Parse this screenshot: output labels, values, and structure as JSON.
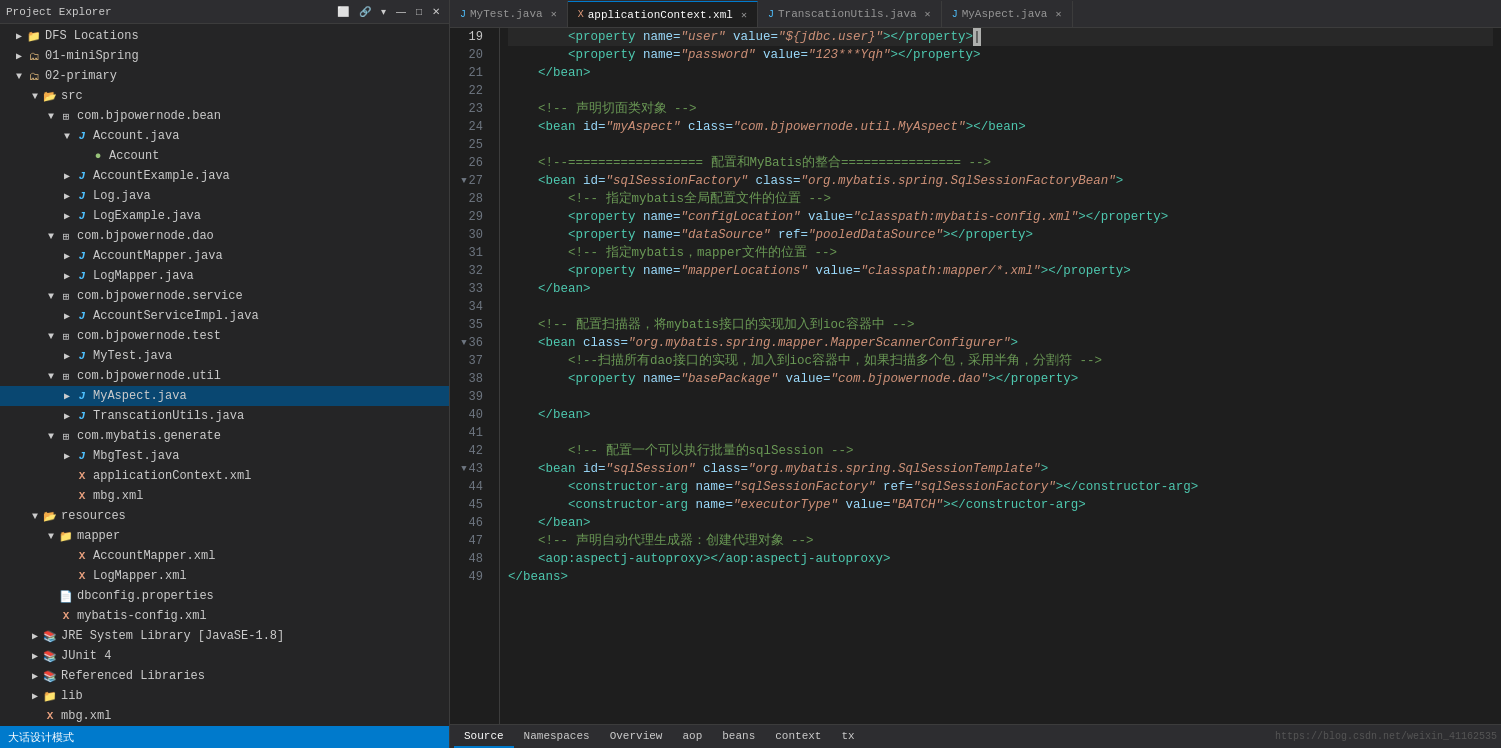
{
  "explorerHeader": {
    "title": "Project Explorer",
    "closeIcon": "✕"
  },
  "tree": {
    "items": [
      {
        "id": "dfs",
        "label": "DFS Locations",
        "level": 1,
        "arrow": "▶",
        "icon": "📁",
        "iconClass": "icon-folder"
      },
      {
        "id": "minispring",
        "label": "01-miniSpring",
        "level": 1,
        "arrow": "▶",
        "icon": "📁",
        "iconClass": "icon-project"
      },
      {
        "id": "primary",
        "label": "02-primary",
        "level": 1,
        "arrow": "▼",
        "icon": "📁",
        "iconClass": "icon-project"
      },
      {
        "id": "src",
        "label": "src",
        "level": 2,
        "arrow": "▼",
        "icon": "📂",
        "iconClass": "icon-folder-src"
      },
      {
        "id": "bean-pkg",
        "label": "com.bjpowernode.bean",
        "level": 3,
        "arrow": "▼",
        "icon": "▦",
        "iconClass": "icon-package"
      },
      {
        "id": "account-java",
        "label": "Account.java",
        "level": 4,
        "arrow": "▼",
        "icon": "J",
        "iconClass": "icon-java"
      },
      {
        "id": "account-class",
        "label": "Account",
        "level": 5,
        "arrow": "",
        "icon": "●",
        "iconClass": "icon-class"
      },
      {
        "id": "accountexample-java",
        "label": "AccountExample.java",
        "level": 4,
        "arrow": "▶",
        "icon": "J",
        "iconClass": "icon-java"
      },
      {
        "id": "log-java",
        "label": "Log.java",
        "level": 4,
        "arrow": "▶",
        "icon": "J",
        "iconClass": "icon-java"
      },
      {
        "id": "logexample-java",
        "label": "LogExample.java",
        "level": 4,
        "arrow": "▶",
        "icon": "J",
        "iconClass": "icon-java"
      },
      {
        "id": "dao-pkg",
        "label": "com.bjpowernode.dao",
        "level": 3,
        "arrow": "▼",
        "icon": "▦",
        "iconClass": "icon-package"
      },
      {
        "id": "accountmapper-java",
        "label": "AccountMapper.java",
        "level": 4,
        "arrow": "▶",
        "icon": "J",
        "iconClass": "icon-java"
      },
      {
        "id": "logmapper-java",
        "label": "LogMapper.java",
        "level": 4,
        "arrow": "▶",
        "icon": "J",
        "iconClass": "icon-java"
      },
      {
        "id": "service-pkg",
        "label": "com.bjpowernode.service",
        "level": 3,
        "arrow": "▼",
        "icon": "▦",
        "iconClass": "icon-package"
      },
      {
        "id": "accountserviceimpl-java",
        "label": "AccountServiceImpl.java",
        "level": 4,
        "arrow": "▶",
        "icon": "J",
        "iconClass": "icon-java"
      },
      {
        "id": "test-pkg",
        "label": "com.bjpowernode.test",
        "level": 3,
        "arrow": "▼",
        "icon": "▦",
        "iconClass": "icon-package"
      },
      {
        "id": "mytest-java",
        "label": "MyTest.java",
        "level": 4,
        "arrow": "▶",
        "icon": "J",
        "iconClass": "icon-java"
      },
      {
        "id": "util-pkg",
        "label": "com.bjpowernode.util",
        "level": 3,
        "arrow": "▼",
        "icon": "▦",
        "iconClass": "icon-package"
      },
      {
        "id": "myaspect-java",
        "label": "MyAspect.java",
        "level": 4,
        "arrow": "▶",
        "icon": "J",
        "iconClass": "icon-java",
        "selected": true
      },
      {
        "id": "transactionutils-java",
        "label": "TranscationUtils.java",
        "level": 4,
        "arrow": "▶",
        "icon": "J",
        "iconClass": "icon-java"
      },
      {
        "id": "generate-pkg",
        "label": "com.mybatis.generate",
        "level": 3,
        "arrow": "▼",
        "icon": "▦",
        "iconClass": "icon-package"
      },
      {
        "id": "mbgtest-java",
        "label": "MbgTest.java",
        "level": 4,
        "arrow": "▶",
        "icon": "J",
        "iconClass": "icon-java"
      },
      {
        "id": "appcontext-xml",
        "label": "applicationContext.xml",
        "level": 4,
        "arrow": "",
        "icon": "X",
        "iconClass": "icon-xml"
      },
      {
        "id": "mbg-xml",
        "label": "mbg.xml",
        "level": 4,
        "arrow": "",
        "icon": "X",
        "iconClass": "icon-xml"
      },
      {
        "id": "resources",
        "label": "resources",
        "level": 2,
        "arrow": "▼",
        "icon": "📂",
        "iconClass": "icon-folder"
      },
      {
        "id": "mapper-folder",
        "label": "mapper",
        "level": 3,
        "arrow": "▼",
        "icon": "📁",
        "iconClass": "icon-folder"
      },
      {
        "id": "accountmapper-xml",
        "label": "AccountMapper.xml",
        "level": 4,
        "arrow": "",
        "icon": "X",
        "iconClass": "icon-xml"
      },
      {
        "id": "logmapper-xml",
        "label": "LogMapper.xml",
        "level": 4,
        "arrow": "",
        "icon": "X",
        "iconClass": "icon-xml"
      },
      {
        "id": "dbconfig-props",
        "label": "dbconfig.properties",
        "level": 3,
        "arrow": "",
        "icon": "P",
        "iconClass": "icon-properties"
      },
      {
        "id": "mybatis-xml",
        "label": "mybatis-config.xml",
        "level": 3,
        "arrow": "",
        "icon": "X",
        "iconClass": "icon-xml"
      },
      {
        "id": "jre-lib",
        "label": "JRE System Library [JavaSE-1.8]",
        "level": 2,
        "arrow": "▶",
        "icon": "📚",
        "iconClass": "icon-jar"
      },
      {
        "id": "junit",
        "label": "JUnit 4",
        "level": 2,
        "arrow": "▶",
        "icon": "📚",
        "iconClass": "icon-jar"
      },
      {
        "id": "ref-libs",
        "label": "Referenced Libraries",
        "level": 2,
        "arrow": "▶",
        "icon": "📚",
        "iconClass": "icon-jar"
      },
      {
        "id": "lib-folder",
        "label": "lib",
        "level": 2,
        "arrow": "▶",
        "icon": "📁",
        "iconClass": "icon-folder"
      },
      {
        "id": "mbg-xml2",
        "label": "mbg.xml",
        "level": 2,
        "arrow": "",
        "icon": "X",
        "iconClass": "icon-xml"
      }
    ]
  },
  "tabs": [
    {
      "id": "mytest",
      "label": "MyTest.java",
      "type": "java",
      "active": false
    },
    {
      "id": "appcontext",
      "label": "applicationContext.xml",
      "type": "xml",
      "active": true
    },
    {
      "id": "transcation",
      "label": "TranscationUtils.java",
      "type": "java",
      "active": false
    },
    {
      "id": "myaspect",
      "label": "MyAspect.java",
      "type": "java",
      "active": false
    }
  ],
  "bottomTabs": [
    {
      "id": "source",
      "label": "Source",
      "active": true
    },
    {
      "id": "namespaces",
      "label": "Namespaces",
      "active": false
    },
    {
      "id": "overview",
      "label": "Overview",
      "active": false
    },
    {
      "id": "aop",
      "label": "aop",
      "active": false
    },
    {
      "id": "beans",
      "label": "beans",
      "active": false
    },
    {
      "id": "context",
      "label": "context",
      "active": false
    },
    {
      "id": "tx",
      "label": "tx",
      "active": false
    }
  ],
  "statusBar": {
    "mode": "大话设计模式",
    "watermark": "https://blog.csdn.net/weixin_41162535"
  },
  "lines": [
    {
      "num": 19,
      "content": "        <property name=\"user\" value=\"${jdbc.user}\"></property>",
      "active": true
    },
    {
      "num": 20,
      "content": "        <property name=\"password\" value=\"123***Yqh\"></property>"
    },
    {
      "num": 21,
      "content": "    </bean>"
    },
    {
      "num": 22,
      "content": ""
    },
    {
      "num": 23,
      "content": "    <!-- 声明切面类对象 -->"
    },
    {
      "num": 24,
      "content": "    <bean id=\"myAspect\" class=\"com.bjpowernode.util.MyAspect\"></bean>"
    },
    {
      "num": 25,
      "content": ""
    },
    {
      "num": 26,
      "content": "    <!--================== 配置和MyBatis的整合================ -->"
    },
    {
      "num": 27,
      "content": "    <bean id=\"sqlSessionFactory\" class=\"org.mybatis.spring.SqlSessionFactoryBean\">",
      "hasFold": true
    },
    {
      "num": 28,
      "content": "        <!-- 指定mybatis全局配置文件的位置 -->"
    },
    {
      "num": 29,
      "content": "        <property name=\"configLocation\" value=\"classpath:mybatis-config.xml\"></property>"
    },
    {
      "num": 30,
      "content": "        <property name=\"dataSource\" ref=\"pooledDataSource\"></property>"
    },
    {
      "num": 31,
      "content": "        <!-- 指定mybatis，mapper文件的位置 -->"
    },
    {
      "num": 32,
      "content": "        <property name=\"mapperLocations\" value=\"classpath:mapper/*.xml\"></property>"
    },
    {
      "num": 33,
      "content": "    </bean>"
    },
    {
      "num": 34,
      "content": ""
    },
    {
      "num": 35,
      "content": "    <!-- 配置扫描器，将mybatis接口的实现加入到ioc容器中 -->"
    },
    {
      "num": 36,
      "content": "    <bean class=\"org.mybatis.spring.mapper.MapperScannerConfigurer\">",
      "hasFold": true
    },
    {
      "num": 37,
      "content": "        <!--扫描所有dao接口的实现，加入到ioc容器中，如果扫描多个包，采用半角，分割符 -->"
    },
    {
      "num": 38,
      "content": "        <property name=\"basePackage\" value=\"com.bjpowernode.dao\"></property>"
    },
    {
      "num": 39,
      "content": "    "
    },
    {
      "num": 40,
      "content": "    </bean>"
    },
    {
      "num": 41,
      "content": ""
    },
    {
      "num": 42,
      "content": "        <!-- 配置一个可以执行批量的sqlSession -->"
    },
    {
      "num": 43,
      "content": "    <bean id=\"sqlSession\" class=\"org.mybatis.spring.SqlSessionTemplate\">",
      "hasFold": true
    },
    {
      "num": 44,
      "content": "        <constructor-arg name=\"sqlSessionFactory\" ref=\"sqlSessionFactory\"></constructor-arg>"
    },
    {
      "num": 45,
      "content": "        <constructor-arg name=\"executorType\" value=\"BATCH\"></constructor-arg>"
    },
    {
      "num": 46,
      "content": "    </bean>"
    },
    {
      "num": 47,
      "content": "    <!-- 声明自动代理生成器：创建代理对象 -->"
    },
    {
      "num": 48,
      "content": "    <aop:aspectj-autoproxy></aop:aspectj-autoproxy>"
    },
    {
      "num": 49,
      "content": "</beans>"
    }
  ]
}
